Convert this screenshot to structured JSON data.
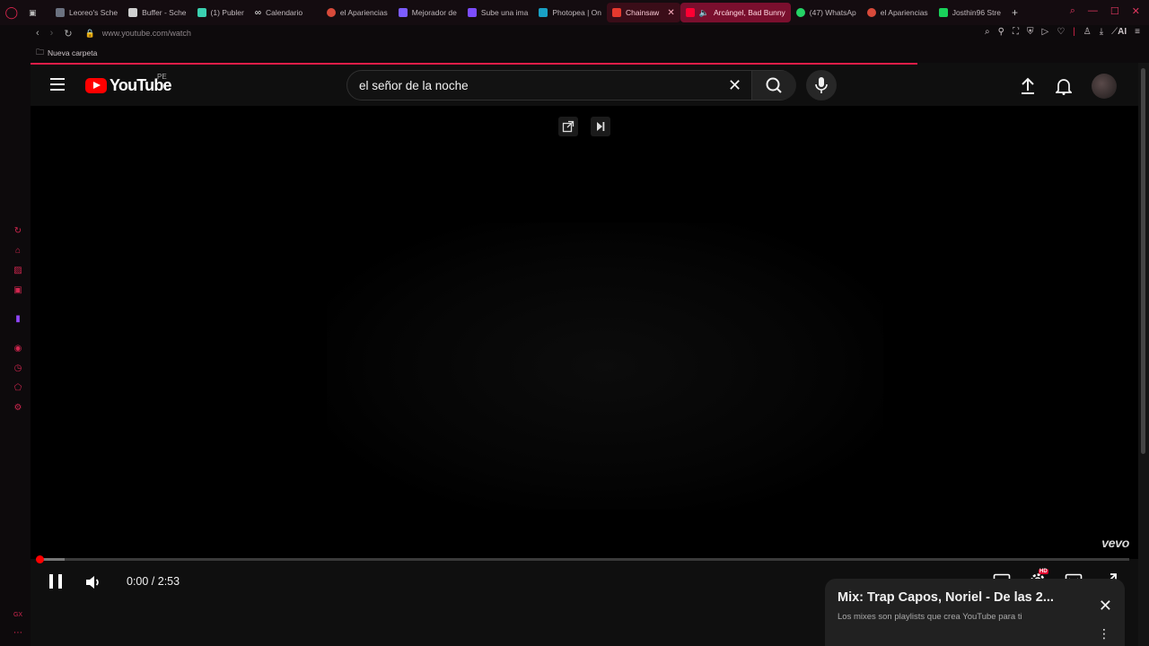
{
  "browser": {
    "tabs": [
      {
        "label": "Leoreo's Sche",
        "color": "#6b7280"
      },
      {
        "label": "Buffer - Sche",
        "color": "#cfcfcf"
      },
      {
        "label": "(1) Publer",
        "color": "#3ad0b0"
      },
      {
        "label": "Calendario",
        "color": "#ffffff"
      },
      {
        "label": "el Apariencias",
        "color": "#d84a3a"
      },
      {
        "label": "Mejorador de",
        "color": "#7b5cff"
      },
      {
        "label": "Sube una ima",
        "color": "#7c4dff"
      },
      {
        "label": "Photopea | On",
        "color": "#19a0c4"
      },
      {
        "label": "Chainsaw",
        "color": "#e6392e"
      },
      {
        "label": "Arcángel, Bad Bunny",
        "color": "#ff0033"
      },
      {
        "label": "(47) WhatsAp",
        "color": "#25d366"
      },
      {
        "label": "el Apariencias",
        "color": "#d84a3a"
      },
      {
        "label": "Josthin96 Stre",
        "color": "#19d15a"
      }
    ],
    "url": "www.youtube.com/watch",
    "bookmark_folder": "Nueva carpeta",
    "ai_label": "AI",
    "rail_bottom_label": "GX"
  },
  "youtube": {
    "logo_text": "YouTube",
    "country_code": "PE",
    "search_query": "el señor de la noche"
  },
  "player": {
    "current_time": "0:00",
    "duration": "2:53",
    "time_display": "0:00 / 2:53",
    "watermark": "vevo",
    "hd_badge": "HD",
    "progress_fraction": 0.0
  },
  "mix_panel": {
    "title": "Mix: Trap Capos, Noriel - De las 2...",
    "subtitle": "Los mixes son playlists que crea YouTube para ti"
  },
  "colors": {
    "accent": "#e11d48",
    "youtube_red": "#ff0000"
  }
}
